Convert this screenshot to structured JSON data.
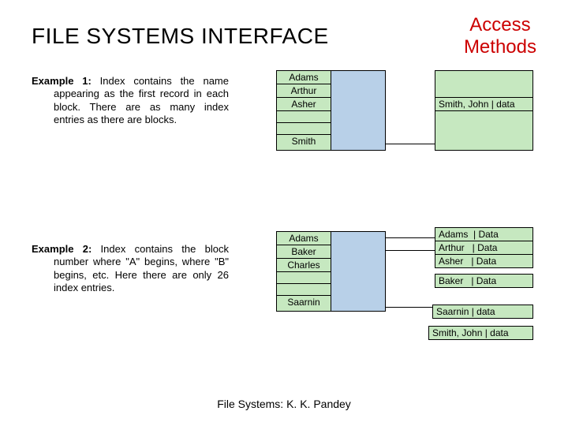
{
  "header": {
    "title": "FILE SYSTEMS INTERFACE",
    "subtitle_line1": "Access",
    "subtitle_line2": "Methods"
  },
  "example1": {
    "label": "Example 1:",
    "text": " Index contains the name appearing as the first record in each block. There are as many index entries as there are blocks."
  },
  "example2": {
    "label": "Example 2:",
    "text": " Index contains the block number where \"A\" begins, where \"B\" begins, etc. Here there are only 26 index entries."
  },
  "diagram1": {
    "index": {
      "r0": "Adams",
      "r1": "Arthur",
      "r2": "Asher",
      "r3": "",
      "r4": "",
      "r5": "Smith"
    },
    "data": {
      "r0": "",
      "r1": "Smith, John | data",
      "r2": ""
    }
  },
  "diagram2": {
    "index": {
      "r0": "Adams",
      "r1": "Baker",
      "r2": "Charles",
      "r3": "",
      "r4": "",
      "r5": "Saarnin"
    },
    "blockA": {
      "r0": "Adams  | Data",
      "r1": "Arthur   | Data",
      "r2": "Asher   | Data"
    },
    "blockB": {
      "r0": "Baker   | Data"
    },
    "blockS": {
      "r0": "Saarnin | data"
    },
    "blockSmith": {
      "r0": "Smith, John | data"
    }
  },
  "footer": "File Systems: K. K. Pandey"
}
